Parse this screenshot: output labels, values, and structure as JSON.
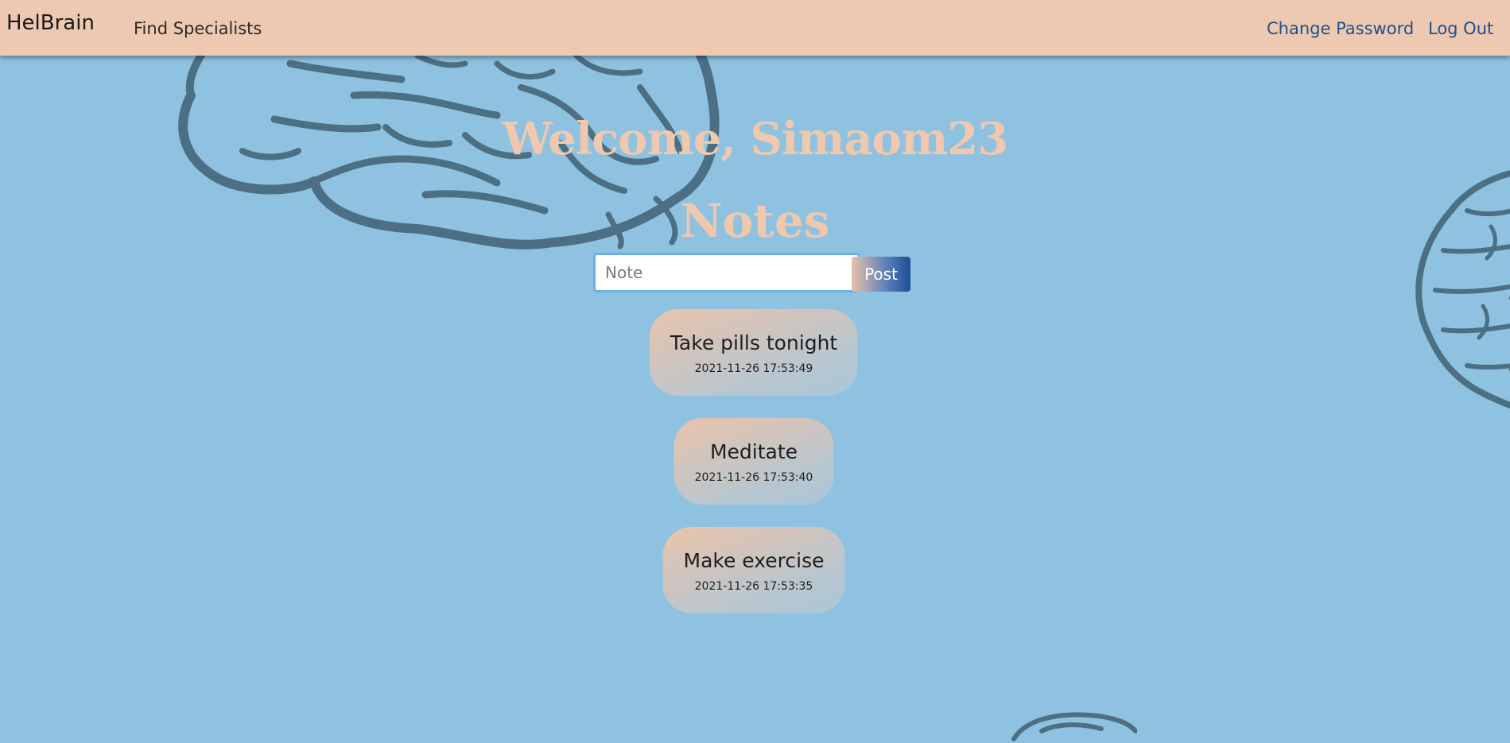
{
  "navbar": {
    "brand": "HelBrain",
    "links": {
      "find_specialists": "Find Specialists",
      "change_password": "Change Password",
      "log_out": "Log Out"
    }
  },
  "main": {
    "welcome": "Welcome, Simaom23",
    "notes_heading": "Notes",
    "note_form": {
      "placeholder": "Note",
      "value": "",
      "post_label": "Post"
    },
    "notes": [
      {
        "title": "Take pills tonight",
        "timestamp": "2021-11-26 17:53:49"
      },
      {
        "title": "Meditate",
        "timestamp": "2021-11-26 17:53:40"
      },
      {
        "title": "Make exercise",
        "timestamp": "2021-11-26 17:53:35"
      }
    ]
  },
  "colors": {
    "background": "#8ec2e0",
    "navbar": "#edc9b1",
    "heading": "#efc8ae",
    "link": "#1f4f8f",
    "brain_outline": "#4c6f84"
  },
  "icons": [
    "brain-illustration"
  ]
}
